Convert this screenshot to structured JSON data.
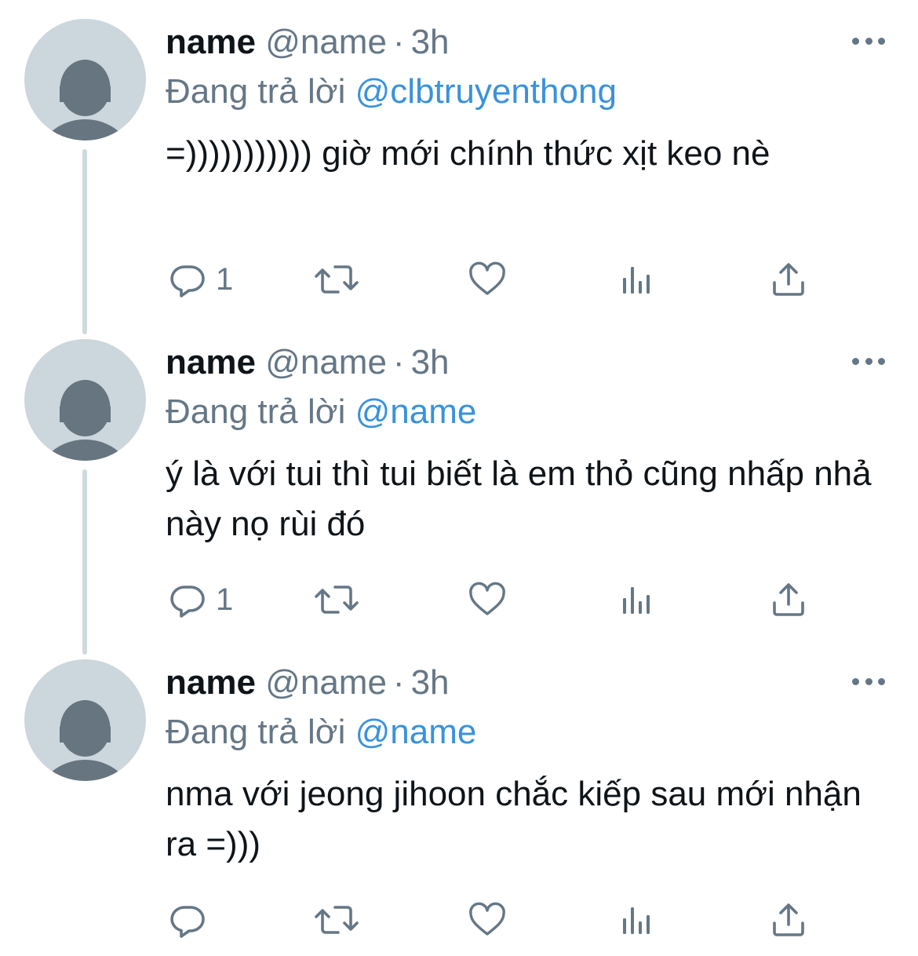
{
  "tweets": [
    {
      "display_name": "name",
      "handle": "@name",
      "separator": "·",
      "time": "3h",
      "reply_prefix": "Đang trả lời",
      "reply_to": "@clbtruyenthong",
      "text": "=))))))))))) giờ mới chính thức xịt keo nè",
      "reply_count": "1"
    },
    {
      "display_name": "name",
      "handle": "@name",
      "separator": "·",
      "time": "3h",
      "reply_prefix": "Đang trả lời",
      "reply_to": "@name",
      "text": "ý là với tui thì tui biết là em thỏ cũng nhấp nhả này nọ rùi đó",
      "reply_count": "1"
    },
    {
      "display_name": "name",
      "handle": "@name",
      "separator": "·",
      "time": "3h",
      "reply_prefix": "Đang trả lời",
      "reply_to": "@name",
      "text": "nma với jeong jihoon chắc kiếp sau mới nhận ra =)))",
      "reply_count": ""
    }
  ],
  "icons": {
    "reply": "reply-icon",
    "retweet": "retweet-icon",
    "like": "heart-icon",
    "views": "analytics-icon",
    "share": "share-icon",
    "more": "more-icon"
  },
  "colors": {
    "text": "#0f1419",
    "secondary": "#657786",
    "mention": "#3a92db",
    "avatar_bg": "#ccd6dd",
    "avatar_fg": "#66757f",
    "thread_line": "#cfd9de"
  }
}
